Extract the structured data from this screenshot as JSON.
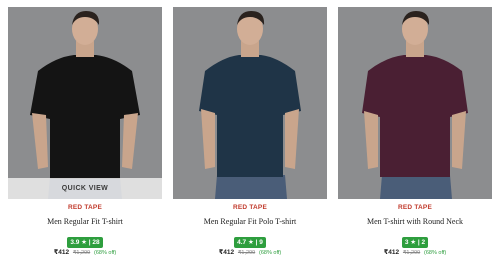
{
  "colors": {
    "brand": "#c0392b",
    "rating_badge": "#2e9e3e",
    "background": "#8a8b8d"
  },
  "quick_view_label": "QUICK VIEW",
  "products": [
    {
      "brand": "RED TAPE",
      "title": "Men Regular Fit T-shirt",
      "rating": "3.9 ★ | 28",
      "price": "₹412",
      "mrp": "₹1,299",
      "discount": "(68% off)",
      "shirt_color": "#141414"
    },
    {
      "brand": "RED TAPE",
      "title": "Men Regular Fit Polo T-shirt",
      "rating": "4.7 ★ | 9",
      "price": "₹412",
      "mrp": "₹1,299",
      "discount": "(68% off)",
      "shirt_color": "#1f3447"
    },
    {
      "brand": "RED TAPE",
      "title": "Men T-shirt with Round Neck",
      "rating": "3 ★ | 2",
      "price": "₹412",
      "mrp": "₹1,299",
      "discount": "(68% off)",
      "shirt_color": "#4a1f33"
    }
  ]
}
